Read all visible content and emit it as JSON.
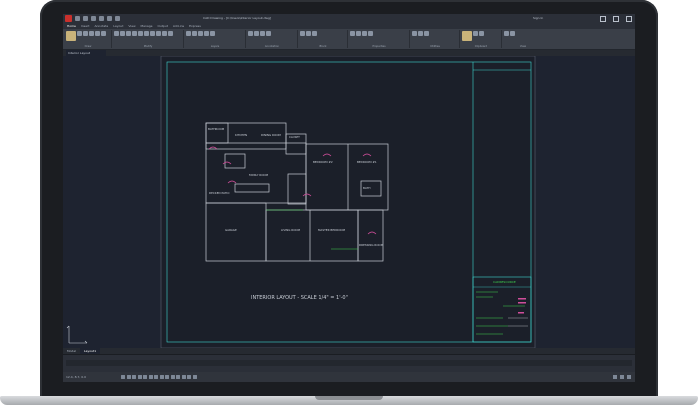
{
  "window": {
    "title": "CAD Drawing - [C:\\Users\\Interior Layout.dwg]",
    "sign_in": "Sign In"
  },
  "ribbon": {
    "tabs": [
      "Home",
      "Insert",
      "Annotate",
      "Layout",
      "View",
      "Manage",
      "Output",
      "Add-ins",
      "Express"
    ],
    "active_tab": "Home",
    "groups": [
      "Draw",
      "Modify",
      "Layers",
      "Annotation",
      "Block",
      "Properties",
      "Utilities",
      "Clipboard",
      "View"
    ]
  },
  "document": {
    "tab_label": "Interior Layout"
  },
  "layout_tabs": [
    "Model",
    "Layout1"
  ],
  "drawing": {
    "caption": "INTERIOR LAYOUT - SCALE 1/4\" = 1'-0\"",
    "rooms": [
      "BATHROOM",
      "KITCHEN",
      "DINING ROOM",
      "CLOSET",
      "BEDROOM #2",
      "BEDROOM #1",
      "FAMILY ROOM",
      "DECKED PATIO",
      "GARAGE",
      "LIVING ROOM",
      "MASTER BEDROOM",
      "BATH",
      "DRESSING ROOM"
    ],
    "title_block": "CADRESOURCE"
  },
  "status": {
    "coords": "12.4, 8.7, 0.0"
  },
  "colors": {
    "background": "#1e2330",
    "wall_line": "#c9ced6",
    "sheet_border": "#3fd7d0",
    "door": "#d04e9a",
    "dimension": "#3fd24f"
  }
}
